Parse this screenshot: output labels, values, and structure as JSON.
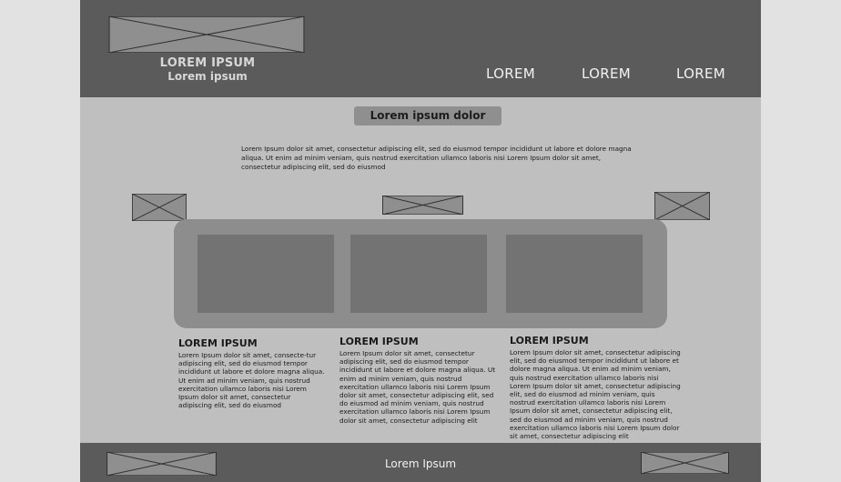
{
  "header": {
    "brand_title": "LOREM IPSUM",
    "brand_subtitle": "Lorem ipsum",
    "nav": [
      "LOREM",
      "LOREM",
      "LOREM"
    ]
  },
  "intro": {
    "title": "Lorem ipsum dolor",
    "text": "Lorem Ipsum dolor sit amet, consectetur adipiscing elit, sed do eiusmod tempor incididunt ut labore et dolore magna aliqua. Ut enim ad minim veniam, quis nostrud exercitation ullamco laboris nisi Lorem Ipsum dolor sit amet, consectetur adipiscing elit, sed do eiusmod"
  },
  "columns": [
    {
      "title": "LOREM IPSUM",
      "text": "Lorem Ipsum dolor sit amet, consecte-tur adipiscing elit, sed do eiusmod tempor incididunt ut labore et dolore magna aliqua. Ut enim ad minim veniam, quis nostrud exercitation ullamco laboris nisi Lorem Ipsum dolor sit amet, consectetur adipiscing elit, sed do eiusmod"
    },
    {
      "title": "LOREM IPSUM",
      "text": "Lorem Ipsum dolor sit amet, consectetur adipiscing elit, sed do eiusmod tempor incididunt ut labore et dolore magna aliqua. Ut enim ad minim veniam, quis nostrud exercitation ullamco laboris nisi Lorem Ipsum dolor sit amet, consectetur adipiscing elit, sed do eiusmod ad minim veniam, quis nostrud exercitation ullamco laboris nisi Lorem Ipsum dolor sit amet, consectetur adipiscing elit"
    },
    {
      "title": "LOREM IPSUM",
      "text": "Lorem Ipsum dolor sit amet, consectetur adipiscing elit, sed do eiusmod tempor incididunt ut labore et dolore magna aliqua. Ut enim ad minim veniam, quis nostrud exercitation ullamco laboris nisi Lorem Ipsum dolor sit amet, consectetur adipiscing elit, sed do eiusmod ad minim veniam, quis nostrud exercitation ullamco laboris nisi Lorem Ipsum dolor sit amet, consectetur adipiscing elit, sed do eiusmod ad minim veniam, quis nostrud exercitation ullamco laboris nisi Lorem Ipsum dolor sit amet, consectetur adipiscing elit"
    }
  ],
  "footer": {
    "text": "Lorem Ipsum"
  },
  "colors": {
    "page_bg": "#e2e2e2",
    "frame_bg": "#bfbfbf",
    "bar_bg": "#5b5b5b",
    "gallery_bg": "#8d8d8d",
    "card_bg": "#737373",
    "placeholder_fill": "#8f8f8f"
  }
}
